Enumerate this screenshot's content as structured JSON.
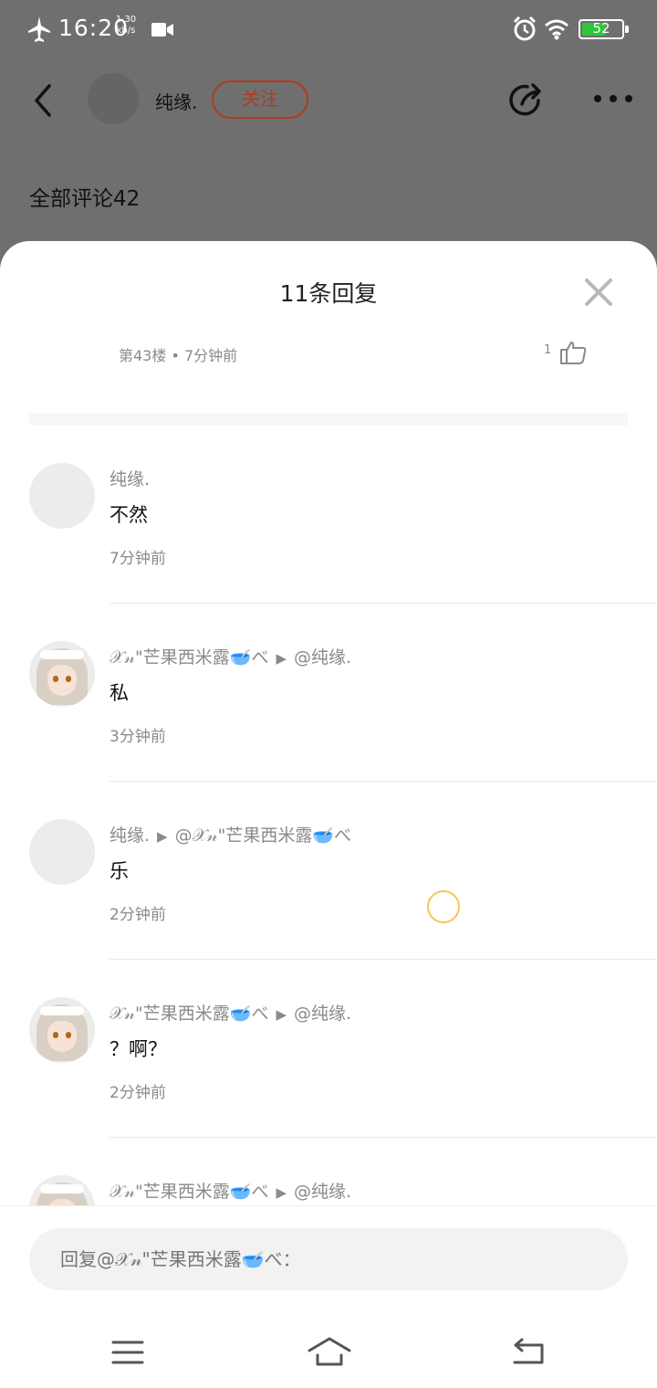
{
  "status_bar": {
    "time": "16:20",
    "net_speed": "1.30",
    "net_unit": "kb/s",
    "battery_level": "52"
  },
  "header": {
    "author_name": "纯缘.",
    "follow_label": "关注",
    "all_comments_label": "全部评论42"
  },
  "sheet": {
    "title": "11条回复",
    "floor_info": "第43楼 • 7分钟前",
    "like_count": "1",
    "replies": [
      {
        "author": "纯缘.",
        "target": "",
        "content": "不然",
        "time": "7分钟前",
        "avatar": "blank"
      },
      {
        "author": "𝒳𝓃\"芒果西米露🥣べ",
        "target": "@纯缘.",
        "content": "私",
        "time": "3分钟前",
        "avatar": "anime"
      },
      {
        "author": "纯缘.",
        "target": "@𝒳𝓃\"芒果西米露🥣べ",
        "content": "乐",
        "time": "2分钟前",
        "avatar": "blank"
      },
      {
        "author": "𝒳𝓃\"芒果西米露🥣べ",
        "target": "@纯缘.",
        "content": "？啊？",
        "time": "2分钟前",
        "avatar": "anime"
      },
      {
        "author": "𝒳𝓃\"芒果西米露🥣べ",
        "target": "@纯缘.",
        "content": "",
        "time": "",
        "avatar": "anime"
      }
    ],
    "input_placeholder": "回复@𝒳𝓃\"芒果西米露🥣べ："
  },
  "icons": {
    "back": "back-arrow-icon",
    "share": "share-icon",
    "more": "more-dots-icon",
    "close": "close-icon",
    "like": "thumbs-up-icon",
    "nav_menu": "menu-icon",
    "nav_home": "home-icon",
    "nav_back": "return-icon"
  },
  "colors": {
    "accent": "#b23a1e",
    "battery": "#2ec73a",
    "overlay": "#6f6f6f"
  }
}
